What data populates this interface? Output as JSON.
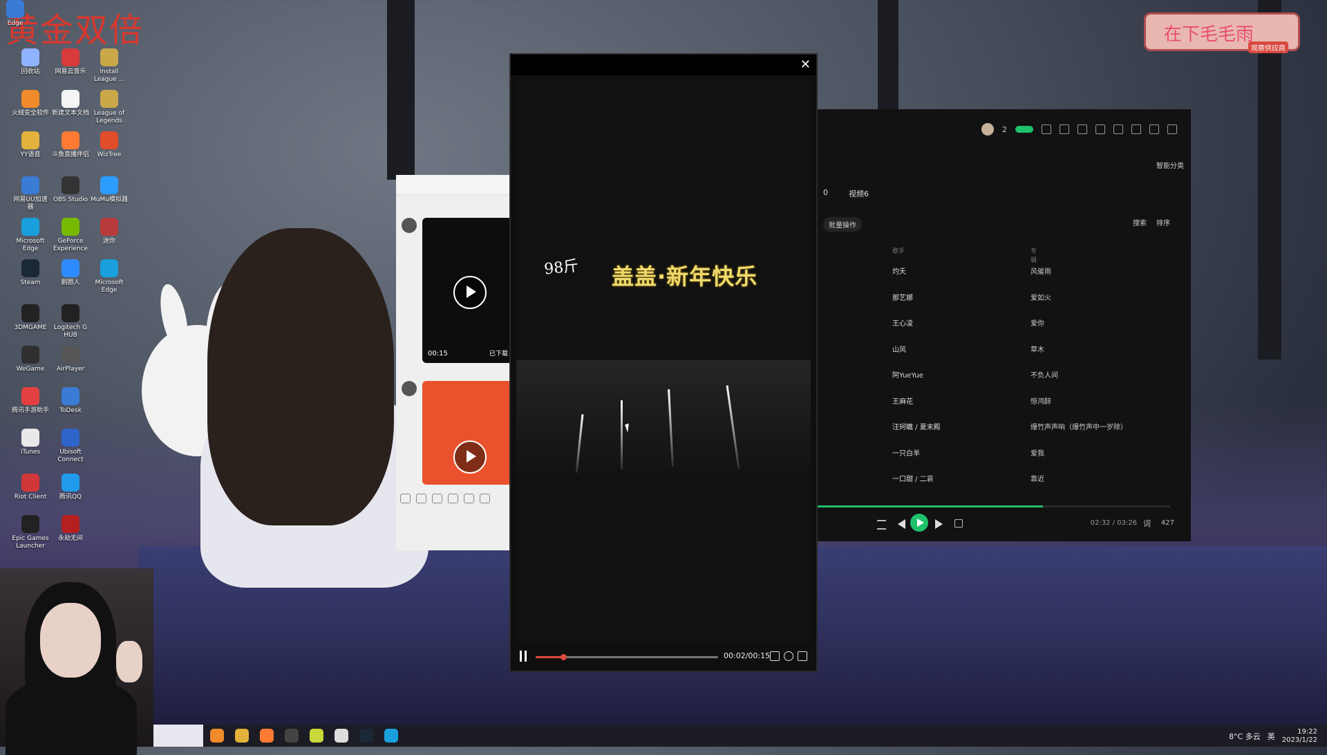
{
  "brand": {
    "top_left_text": "黄金双倍"
  },
  "badge": {
    "text": "在下毛毛雨",
    "sub": "观察供应商"
  },
  "desktop_icons": [
    {
      "label": "Edge",
      "color": "#3a7bd5"
    },
    {
      "label": "回收站",
      "color": "#8fb3ff"
    },
    {
      "label": "网易云音乐",
      "color": "#d93b3b"
    },
    {
      "label": "Install League ...",
      "color": "#c9a84a"
    },
    {
      "label": "火绒安全软件",
      "color": "#f08a2b"
    },
    {
      "label": "新建文本文档",
      "color": "#f4f4f4"
    },
    {
      "label": "League of Legends",
      "color": "#c9a84a"
    },
    {
      "label": "YY语音",
      "color": "#e2b23c"
    },
    {
      "label": "斗鱼直播伴侣",
      "color": "#ff7a33"
    },
    {
      "label": "WizTree",
      "color": "#e14d2a"
    },
    {
      "label": "网易UU加速器",
      "color": "#3a7bd5"
    },
    {
      "label": "OBS Studio",
      "color": "#333333"
    },
    {
      "label": "MuMu模拟器",
      "color": "#2d9cff"
    },
    {
      "label": "Microsoft Edge",
      "color": "#1a9fdd"
    },
    {
      "label": "GeForce Experience",
      "color": "#76b900"
    },
    {
      "label": "迷你",
      "color": "#b93b3b"
    },
    {
      "label": "Steam",
      "color": "#1b2838"
    },
    {
      "label": "鹅圈人",
      "color": "#2e8bff"
    },
    {
      "label": "Microsoft Edge",
      "color": "#1a9fdd"
    },
    {
      "label": "3DMGAME",
      "color": "#222222"
    },
    {
      "label": "Logitech G HUB",
      "color": "#222222"
    },
    {
      "label": "WeGame",
      "color": "#2f2f2f"
    },
    {
      "label": "AirPlayer",
      "color": "#555555"
    },
    {
      "label": "腾讯手游助手",
      "color": "#e34141"
    },
    {
      "label": "ToDesk",
      "color": "#3a7bd5"
    },
    {
      "label": "iTunes",
      "color": "#e9e9e9"
    },
    {
      "label": "Ubisoft Connect",
      "color": "#2f64c9"
    },
    {
      "label": "Riot Client",
      "color": "#d13639"
    },
    {
      "label": "腾讯QQ",
      "color": "#1f9bea"
    },
    {
      "label": "Epic Games Launcher",
      "color": "#222222"
    },
    {
      "label": "永劫无间",
      "color": "#b51f1f"
    }
  ],
  "chat": {
    "video1": {
      "time": "00:15",
      "status": "已下载"
    },
    "video2": {
      "time": ""
    }
  },
  "music": {
    "smart_label": "智能分类",
    "tabs": [
      "0",
      "视频6"
    ],
    "batch_label": "批量操作",
    "search_label": "搜索",
    "sort_label": "排序",
    "col_singer": "歌手",
    "col_album": "专辑",
    "avatar_count": "2",
    "rows": [
      {
        "singer": "灼夭",
        "album": "风催雨"
      },
      {
        "singer": "那艺娜",
        "album": "爱如火"
      },
      {
        "singer": "王心凌",
        "album": "爱你"
      },
      {
        "singer": "山风",
        "album": "草木"
      },
      {
        "singer": "阿YueYue",
        "album": "不负人间"
      },
      {
        "singer": "王麻花",
        "album": "惊鸿醉"
      },
      {
        "singer": "汪珂瞩 / 夏末殿",
        "album": "爆竹声声响（爆竹声中一岁除）"
      },
      {
        "singer": "一只白羊",
        "album": "爱我"
      },
      {
        "singer": "一口甜 / 二哀",
        "album": "靠近"
      }
    ],
    "progress": 0.64,
    "time": "02:32 / 03:26",
    "lyric_label": "词",
    "playlist_count": "427"
  },
  "player": {
    "close_glyph": "✕",
    "caption_left": "98斤",
    "caption_main": "盖盖·新年快乐",
    "progress": 0.15,
    "time": "00:02/00:15"
  },
  "tray": {
    "weather": "8°C 多云",
    "ime": "英",
    "time": "19:22",
    "date": "2023/1/22"
  }
}
